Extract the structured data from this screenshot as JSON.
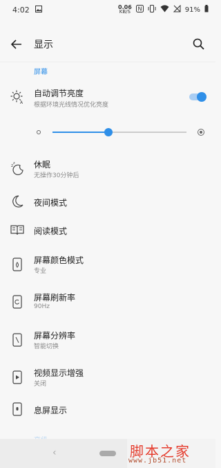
{
  "status_bar": {
    "time": "4:02",
    "net_speed": "0.06",
    "net_unit": "KB/S",
    "battery": "91%"
  },
  "toolbar": {
    "title": "显示"
  },
  "section": {
    "header": "屏幕"
  },
  "auto_brightness": {
    "title": "自动调节亮度",
    "subtitle": "根据环境光线情况优化亮度",
    "enabled": true
  },
  "brightness": {
    "level": 0.42
  },
  "items": [
    {
      "title": "休眠",
      "subtitle": "无操作30分钟后",
      "icon": "sleep-icon"
    },
    {
      "title": "夜间模式",
      "subtitle": "",
      "icon": "moon-icon"
    },
    {
      "title": "阅读模式",
      "subtitle": "",
      "icon": "book-icon"
    },
    {
      "title": "屏幕颜色模式",
      "subtitle": "专业",
      "icon": "screen-color-icon"
    },
    {
      "title": "屏幕刷新率",
      "subtitle": "90Hz",
      "icon": "refresh-rate-icon"
    },
    {
      "title": "屏幕分辨率",
      "subtitle": "智能切换",
      "icon": "resolution-icon"
    },
    {
      "title": "视频显示增强",
      "subtitle": "关闭",
      "icon": "video-enhance-icon"
    },
    {
      "title": "息屏显示",
      "subtitle": "",
      "icon": "ambient-display-icon"
    }
  ],
  "next_section": {
    "header": "高级"
  },
  "watermark": {
    "title": "脚本之家",
    "url": "www.jb51.net"
  },
  "colors": {
    "accent": "#2f8fe8",
    "background": "#f7f7f7",
    "watermark": "#e53b2c"
  }
}
